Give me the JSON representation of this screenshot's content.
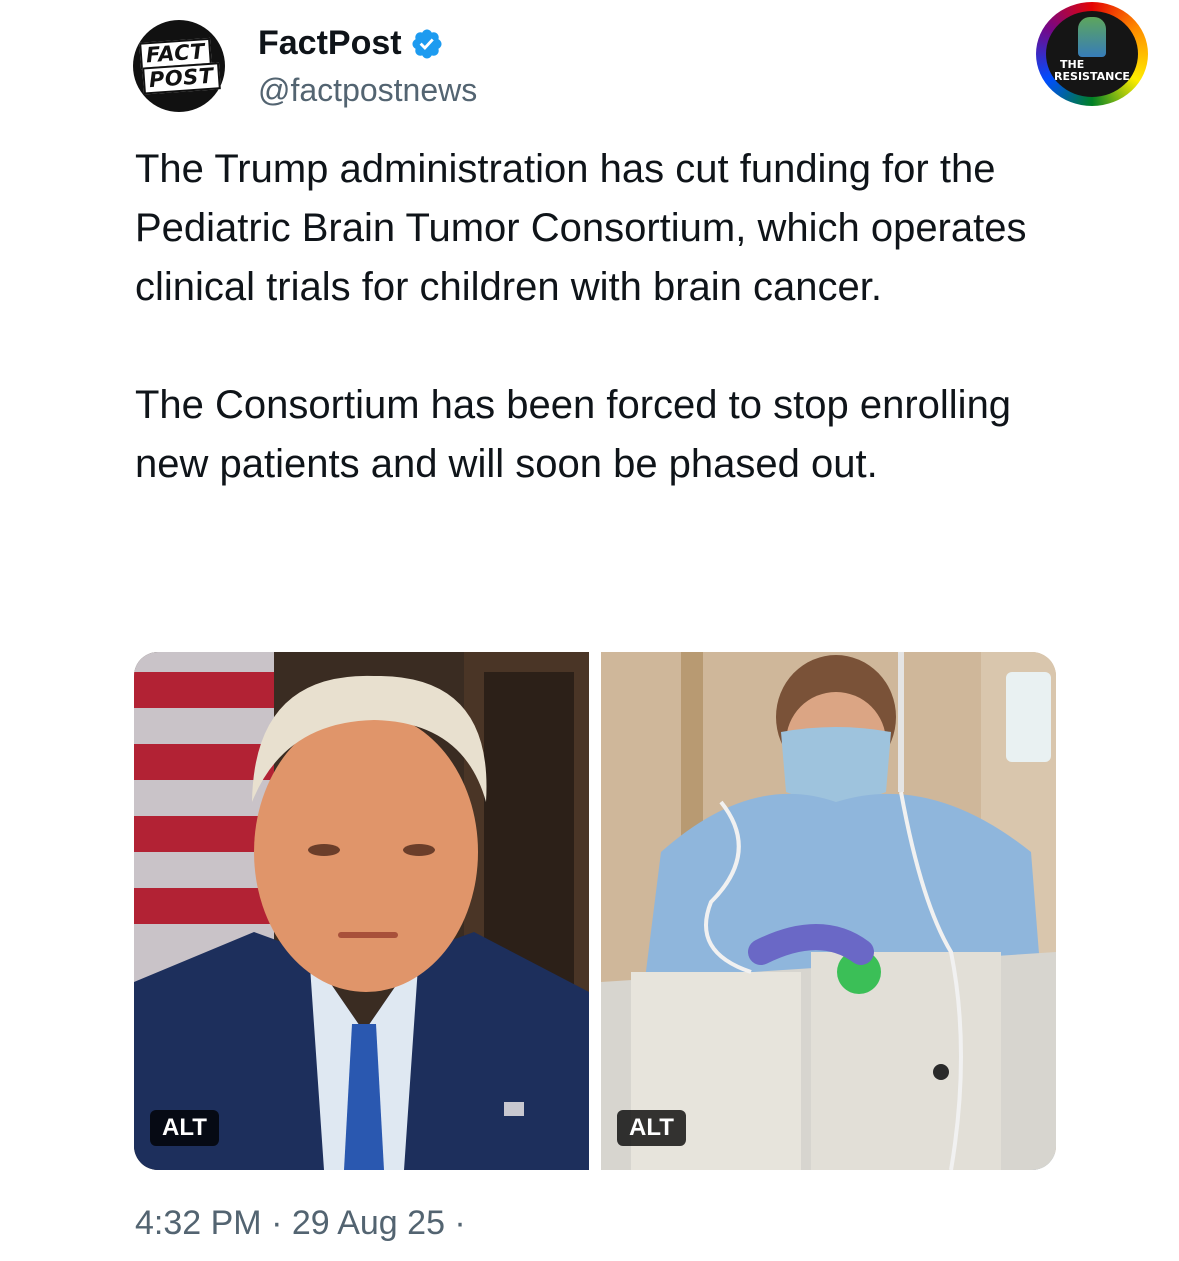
{
  "author": {
    "avatar_lines": [
      "FACT",
      "POST"
    ],
    "display_name": "FactPost",
    "handle": "@factpostnews",
    "verified": true,
    "verified_color": "#1d9bf0"
  },
  "watermark": {
    "line1": "THE",
    "line2": "RESISTANCE"
  },
  "tweet": {
    "paragraphs": [
      "The Trump administration has cut funding for the Pediatric Brain Tumor Consortium, which operates clinical trials for children with brain cancer.",
      "The Consortium has been forced to stop enrolling new patients and will soon be phased out."
    ]
  },
  "media": [
    {
      "alt_label": "ALT",
      "icon": "portrait-photo"
    },
    {
      "alt_label": "ALT",
      "icon": "hospital-photo"
    }
  ],
  "footer": {
    "timestamp": "4:32 PM · 29 Aug 25 ·"
  }
}
